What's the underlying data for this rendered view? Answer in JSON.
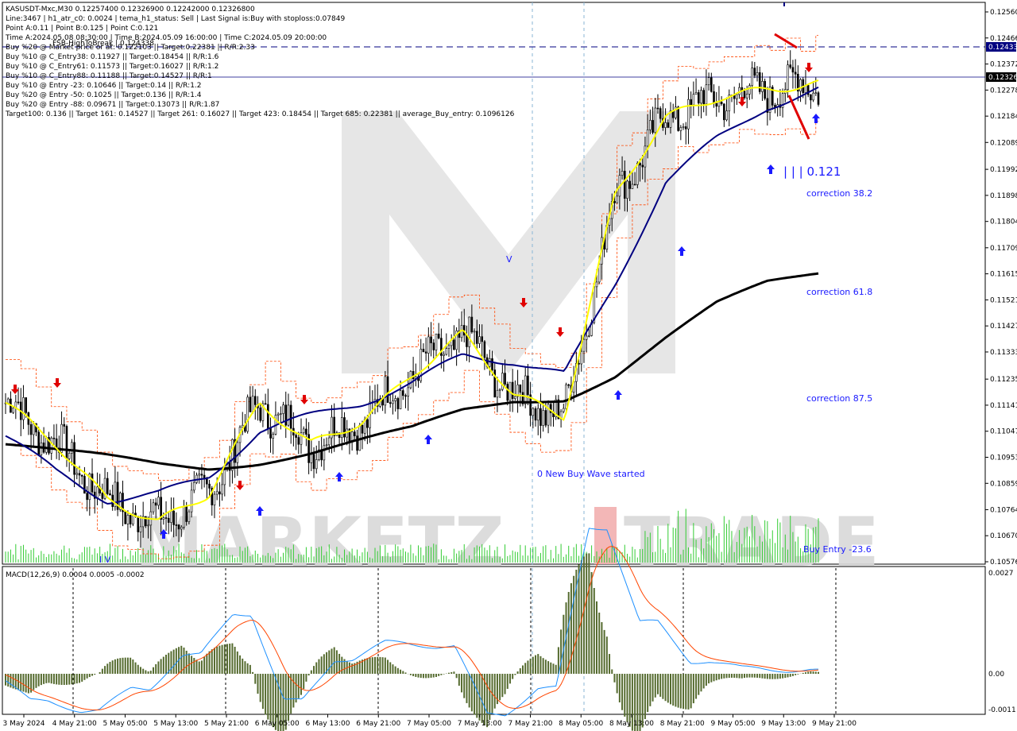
{
  "window": {
    "symbol_line": "KASUSDT-Mxc,M30  0.12257400 0.12326900 0.12242000 0.12326800",
    "info_lines": [
      "Line:3467  |  h1_atr_c0: 0.0024  |  tema_h1_status: Sell  |  Last Signal is:Buy with stoploss:0.07849",
      "Point A:0.11  |  Point B:0.125  |  Point C:0.121",
      "Time A:2024.05.08 08:30:00  |  Time B:2024.05.09 16:00:00  |  Time C:2024.05.09 20:00:00",
      "Buy %20 @ Market price or at: 0.122103  ||  Target:0.22381  ||  R/R:2.33",
      "Buy %10 @ C_Entry38: 0.11927  ||  Target:0.18454  ||  R/R:1.6",
      "Buy %10 @ C_Entry61: 0.11573  ||  Target:0.16027  ||  R/R:1.2",
      "Buy %10 @ C_Entry88: 0.11188  ||  Target:0.14527  ||  R/R:1",
      "Buy %10 @ Entry -23: 0.10646  ||  Target:0.14  ||  R/R:1.2",
      "Buy %20 @ Entry -50: 0.1025  ||  Target:0.136  ||  R/R:1.4",
      "Buy %20 @ Entry -88: 0.09671  ||  Target:0.13073  ||  R/R:1.87",
      "Target100: 0.136  ||  Target 161: 0.14527  ||  Target 261: 0.16027  ||  Target 423: 0.18454  ||  Target 685: 0.22381  ||  average_Buy_entry: 0.1096126"
    ],
    "fsb_label": "FSB-HighToBreak  |  0.124338"
  },
  "annotations": {
    "point_c": "| | | 0.121",
    "corr38": "correction 38.2",
    "corr61": "correction 61.8",
    "corr87": "correction 87.5",
    "new_wave": "0 New Buy Wave started",
    "buy_entry": "Buy Entry -23.6",
    "marker_v": "V",
    "marker_iv": "I V"
  },
  "watermark": {
    "left": "MARKETZ",
    "i": "I",
    "right": "TRADE"
  },
  "price_axis": {
    "ticks": [
      "0.12560",
      "0.12466",
      "0.12372",
      "0.12278",
      "0.12184",
      "0.12089",
      "0.11992",
      "0.11898",
      "0.11804",
      "0.11709",
      "0.11615",
      "0.11521",
      "0.11427",
      "0.11333",
      "0.11235",
      "0.11141",
      "0.11047",
      "0.10953",
      "0.10859",
      "0.10764",
      "0.10670",
      "0.10576"
    ],
    "tag_fsb": "0.12433",
    "tag_price": "0.12326"
  },
  "time_axis": {
    "labels": [
      "3 May 2024",
      "4 May 21:00",
      "5 May 05:00",
      "5 May 13:00",
      "5 May 21:00",
      "6 May 05:00",
      "6 May 13:00",
      "6 May 21:00",
      "7 May 05:00",
      "7 May 13:00",
      "7 May 21:00",
      "8 May 05:00",
      "8 May 13:00",
      "8 May 21:00",
      "9 May 05:00",
      "9 May 13:00",
      "9 May 21:00"
    ]
  },
  "macd": {
    "label": "MACD(12,26,9) 0.0004 0.0005 -0.0002",
    "ticks": [
      "0.0027",
      "0.00",
      "-0.0011"
    ]
  },
  "colors": {
    "bg": "#ffffff",
    "candle": "#000000",
    "ma_yellow": "#ffff00",
    "ma_navy": "#000080",
    "ma_black": "#000000",
    "stop_line": "#ff4500",
    "up_arrow": "#1a1aff",
    "down_arrow": "#e00000",
    "volume": "#33cc33",
    "macd_hist": "#556b2f",
    "macd_main": "#1e90ff",
    "macd_signal": "#ff4500",
    "watermark": "#d9d9d9",
    "watermark_i": "#f2b0b0",
    "axis_tag": "#000080"
  },
  "chart_data": {
    "type": "candlestick",
    "title": "KASUSDT-Mxc,M30",
    "ylim": [
      0.10576,
      0.1256
    ],
    "current_price": 0.123268,
    "levels": [
      0.124338,
      0.123268
    ],
    "x": [
      "3 May 2024",
      "4 May 21:00",
      "5 May 05:00",
      "5 May 13:00",
      "5 May 21:00",
      "6 May 05:00",
      "6 May 13:00",
      "6 May 21:00",
      "7 May 05:00",
      "7 May 13:00",
      "7 May 21:00",
      "8 May 05:00",
      "8 May 13:00",
      "8 May 21:00",
      "9 May 05:00",
      "9 May 13:00",
      "9 May 21:00"
    ],
    "series": [
      {
        "values": [
          0.1115,
          0.11,
          0.108,
          0.1072,
          0.1082,
          0.1115,
          0.11,
          0.1108,
          0.1125,
          0.114,
          0.1118,
          0.111,
          0.119,
          0.1218,
          0.1225,
          0.1228,
          0.123
        ]
      },
      {
        "values": [
          0.1103,
          0.109,
          0.108,
          0.1082,
          0.1088,
          0.1105,
          0.111,
          0.1115,
          0.1122,
          0.1132,
          0.113,
          0.1125,
          0.1158,
          0.1195,
          0.121,
          0.1222,
          0.1228
        ]
      },
      {
        "values": [
          0.11,
          0.1097,
          0.1095,
          0.1093,
          0.1092,
          0.1094,
          0.1097,
          0.1101,
          0.1105,
          0.1112,
          0.1116,
          0.1117,
          0.1125,
          0.1138,
          0.115,
          0.1158,
          0.1162
        ]
      }
    ]
  }
}
